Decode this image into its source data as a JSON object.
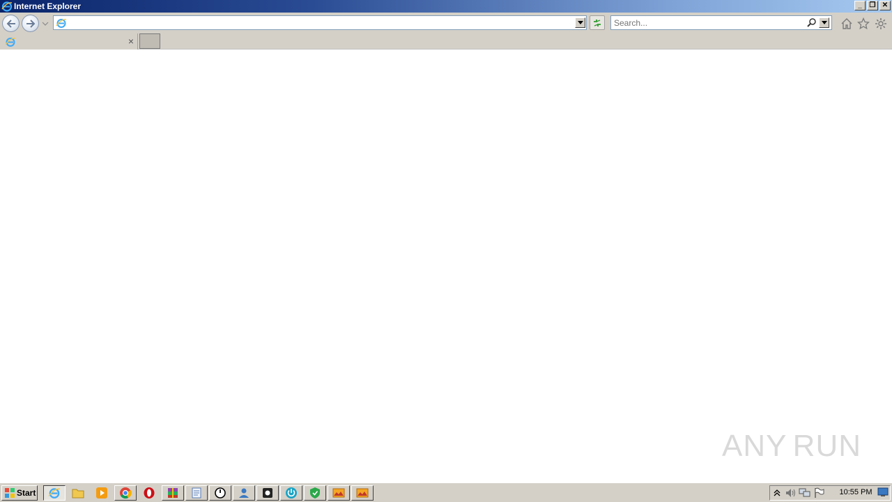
{
  "window": {
    "title": "Internet Explorer",
    "controls": {
      "minimize": "_",
      "restore": "❐",
      "close": "✕"
    }
  },
  "navbar": {
    "address_value": "",
    "search_placeholder": "Search..."
  },
  "tabs": [
    {
      "label": "",
      "close": "×"
    }
  ],
  "watermark": {
    "text_left": "ANY",
    "text_right": "RUN"
  },
  "taskbar": {
    "start_label": "Start",
    "apps": [
      "internet-explorer",
      "file-explorer",
      "media-player",
      "chrome",
      "opera",
      "winrar",
      "notepad",
      "clock-app",
      "installer",
      "camera-app",
      "power-app",
      "shield-app",
      "picture-app",
      "picture-app-2"
    ],
    "clock": "10:55 PM"
  },
  "colors": {
    "title_bar_start": "#0a246a",
    "title_bar_end": "#a6caf0",
    "chrome_gray": "#d4d0c8"
  }
}
